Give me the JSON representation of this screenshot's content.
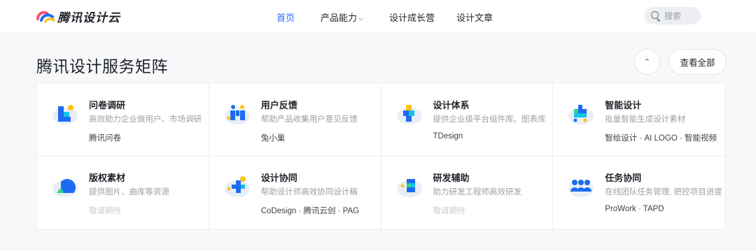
{
  "header": {
    "logo_text": "腾讯设计云",
    "nav": [
      {
        "label": "首页",
        "active": true
      },
      {
        "label": "产品能力",
        "has_dropdown": true
      },
      {
        "label": "设计成长营"
      },
      {
        "label": "设计文章"
      }
    ],
    "search": {
      "placeholder": "搜索",
      "value": ""
    }
  },
  "section": {
    "title": "腾讯设计服务矩阵",
    "collapse_icon": "chevron-up-icon",
    "view_all_label": "查看全部"
  },
  "cards": [
    {
      "title": "问卷调研",
      "desc": "高效助力企业做用户、市场调研",
      "link": "腾讯问卷",
      "icon": "survey-icon"
    },
    {
      "title": "用户反馈",
      "desc": "帮助产品收集用户意见反馈",
      "link": "兔小巢",
      "icon": "feedback-icon"
    },
    {
      "title": "设计体系",
      "desc": "提供企业级平台组件库、图表库",
      "link": "TDesign",
      "icon": "design-system-icon"
    },
    {
      "title": "智能设计",
      "desc": "批量智能生成设计素材",
      "link": "智绘设计 · AI LOGO · 智能视频",
      "icon": "smart-design-icon"
    },
    {
      "title": "版权素材",
      "desc": "提供图片、曲库等资源",
      "link": "敬请期待",
      "muted": true,
      "icon": "copyright-icon"
    },
    {
      "title": "设计协同",
      "desc": "帮助设计师高效协同设计稿",
      "link": "CoDesign · 腾讯云创 · PAG",
      "icon": "collab-icon"
    },
    {
      "title": "研发辅助",
      "desc": "助力研发工程师高效研发",
      "link": "敬请期待",
      "muted": true,
      "icon": "dev-assist-icon"
    },
    {
      "title": "任务协同",
      "desc": "在线团队任务管理, 把控项目进度",
      "link": "ProWork · TAPD",
      "icon": "task-icon"
    }
  ],
  "colors": {
    "accent": "#2a6bff",
    "blue": "#1c6cf2",
    "cyan": "#10c3e6",
    "green": "#2fd38b",
    "yellow": "#ffc21a",
    "cloud": "#e9eef6"
  }
}
